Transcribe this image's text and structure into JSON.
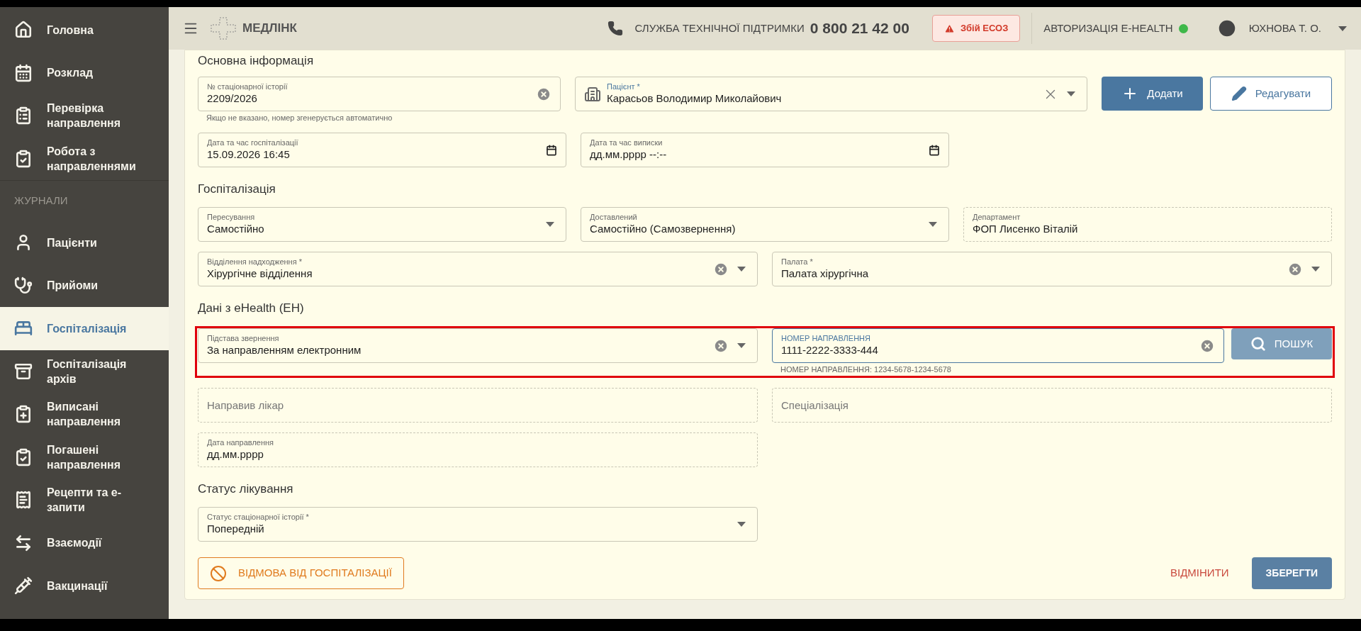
{
  "sidebar": {
    "items": [
      {
        "kind": "link",
        "label": "Головна",
        "selected": false
      },
      {
        "kind": "link",
        "label": "Розклад",
        "selected": false
      },
      {
        "kind": "link",
        "label": "Перевірка направлення",
        "selected": false
      },
      {
        "kind": "link",
        "label": "Робота з направленнями",
        "selected": false
      },
      {
        "kind": "section",
        "label": "ЖУРНАЛИ"
      },
      {
        "kind": "link",
        "label": "Пацієнти",
        "selected": false
      },
      {
        "kind": "link",
        "label": "Прийоми",
        "selected": false
      },
      {
        "kind": "link",
        "label": "Госпіталізація",
        "selected": true
      },
      {
        "kind": "link",
        "label": "Госпіталізація архів",
        "selected": false
      },
      {
        "kind": "link",
        "label": "Виписані направлення",
        "selected": false
      },
      {
        "kind": "link",
        "label": "Погашені направлення",
        "selected": false
      },
      {
        "kind": "link",
        "label": "Рецепти та е-запити",
        "selected": false
      },
      {
        "kind": "link",
        "label": "Взаємодії",
        "selected": false
      },
      {
        "kind": "link",
        "label": "Вакцинації",
        "selected": false
      }
    ]
  },
  "header": {
    "logo": "МЕДЛІНК",
    "support_label": "СЛУЖБА ТЕХНІЧНОЇ ПІДТРИМКИ",
    "support_phone": "0 800 21 42 00",
    "alert": "Збій ЕСОЗ",
    "auth_label": "АВТОРИЗАЦІЯ E-HEALTH",
    "auth_connected": true,
    "user": "ЮХНОВА Т. О."
  },
  "form": {
    "sections": [
      {
        "title": "Основна інформація",
        "rows": [
          {
            "kind": "patient",
            "fields": [
              {
                "kind": "input",
                "label": "№ стаціонарної історії",
                "value": "2209/2026",
                "clearable": true,
                "helper": "Якщо не вказано, номер згенерується автоматично"
              },
              {
                "kind": "entity",
                "label": "Пацієнт *",
                "value": "Карасьов Володимир Миколайович"
              }
            ],
            "buttons": [
              {
                "kind": "primary",
                "label": "Додати"
              },
              {
                "kind": "outline",
                "label": "Редагувати"
              }
            ]
          },
          {
            "kind": "thirds",
            "fields": [
              {
                "kind": "date",
                "label": "Дата та час госпіталізації",
                "value": "15.09.2026 16:45"
              },
              {
                "kind": "date",
                "label": "Дата та час виписки",
                "value": "дд.мм.рррр --:--"
              }
            ]
          }
        ]
      },
      {
        "title": "Госпіталізація",
        "rows": [
          {
            "kind": "thirds",
            "fields": [
              {
                "kind": "select",
                "label": "Пересування",
                "value": "Самостійно",
                "clearable": false
              },
              {
                "kind": "select",
                "label": "Доставлений",
                "value": "Самостійно (Самозвернення)",
                "clearable": false
              },
              {
                "kind": "readonly",
                "label": "Департамент",
                "value": "ФОП Лисенко Віталій"
              }
            ]
          },
          {
            "kind": "halves",
            "fields": [
              {
                "kind": "select",
                "label": "Відділення надходження *",
                "value": "Хірургічне відділення",
                "clearable": true
              },
              {
                "kind": "select",
                "label": "Палата *",
                "value": "Палата хірургічна",
                "clearable": true
              }
            ]
          }
        ]
      },
      {
        "title": "Дані з eHealth (ЕН)",
        "rows": [
          {
            "kind": "search",
            "highlighted": true,
            "fields": [
              {
                "kind": "select",
                "label": "Підстава звернення",
                "value": "За направленням електронним",
                "clearable": true
              },
              {
                "kind": "input",
                "label": "НОМЕР НАПРАВЛЕННЯ",
                "value": "1111-2222-3333-444",
                "clearable": true,
                "focused": true,
                "helper": "НОМЕР НАПРАВЛЕННЯ: 1234-5678-1234-5678"
              }
            ],
            "buttons": [
              {
                "kind": "search",
                "label": "ПОШУК",
                "disabled": true
              }
            ]
          },
          {
            "kind": "halves",
            "fields": [
              {
                "kind": "readonly",
                "placeholder": "Направив лікар"
              },
              {
                "kind": "readonly",
                "placeholder": "Спеціалізація"
              }
            ]
          },
          {
            "kind": "halves",
            "fields": [
              {
                "kind": "readonly",
                "label": "Дата направлення",
                "value": "дд.мм.рррр"
              }
            ]
          }
        ]
      },
      {
        "title": "Статус лікування",
        "rows": [
          {
            "kind": "halves",
            "fields": [
              {
                "kind": "select",
                "label": "Статус стаціонарної історії *",
                "value": "Попередній",
                "clearable": false
              }
            ]
          }
        ]
      }
    ],
    "actions": {
      "refuse": "ВІДМОВА ВІД ГОСПІТАЛІЗАЦІЇ",
      "cancel": "ВІДМІНИТИ",
      "save": "ЗБЕРЕГТИ"
    }
  }
}
